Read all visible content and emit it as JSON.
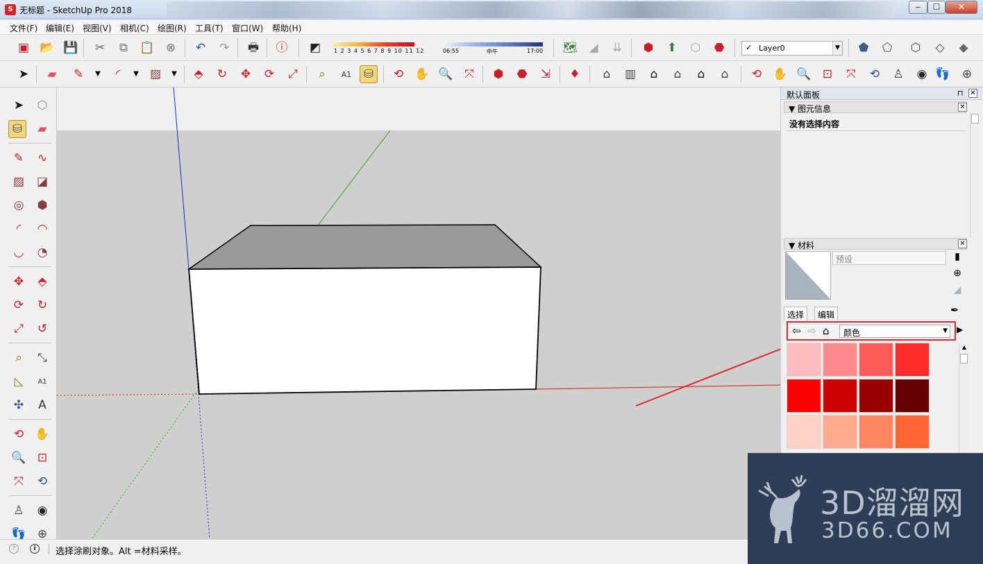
{
  "window": {
    "title": "无标题 - SketchUp Pro 2018",
    "app_icon": "sketchup-icon",
    "buttons": {
      "minimize": "‒",
      "maximize": "☐",
      "close": "✕"
    }
  },
  "menu": [
    "文件(F)",
    "编辑(E)",
    "视图(V)",
    "相机(C)",
    "绘图(R)",
    "工具(T)",
    "窗口(W)",
    "帮助(H)"
  ],
  "toolbar": {
    "shadow_months": "1 2 3 4 5 6 7 8 9 10 11 12",
    "time_start": "06:55",
    "time_mid": "中午",
    "time_end": "17:00",
    "layer_check": "✓",
    "layer": "Layer0"
  },
  "panel": {
    "title": "默认面板",
    "pin": "⊓",
    "close": "✕",
    "entity_info": {
      "header": "▼ 图元信息",
      "close": "✕",
      "empty": "没有选择内容"
    },
    "materials": {
      "header": "▼ 材料",
      "close": "✕",
      "name_placeholder": "预设",
      "tab_select": "选择",
      "tab_edit": "编辑",
      "library": "颜色",
      "library_dd": "▼",
      "swatch_colors": [
        "#ffbcbc",
        "#ff8c8c",
        "#ff5a5a",
        "#ff2a2a",
        "#ff0000",
        "#cc0000",
        "#990000",
        "#660000",
        "#ffd2c8",
        "#ffa98e",
        "#ff8460",
        "#ff6633"
      ]
    }
  },
  "status": {
    "message": "选择涂刷对象。Alt =材料采样。"
  },
  "watermark": {
    "line1": "3D溜溜网",
    "line2": "3D66.COM"
  },
  "colors": {
    "highlight_red": "#e0262e",
    "axis_red": "#cc1f1f",
    "axis_green": "#1faa1f",
    "axis_blue": "#2222cc",
    "box_top": "#9a9a9a",
    "box_front": "#ffffff",
    "sky": "#eef0f2",
    "ground": "#cfcfcd"
  }
}
